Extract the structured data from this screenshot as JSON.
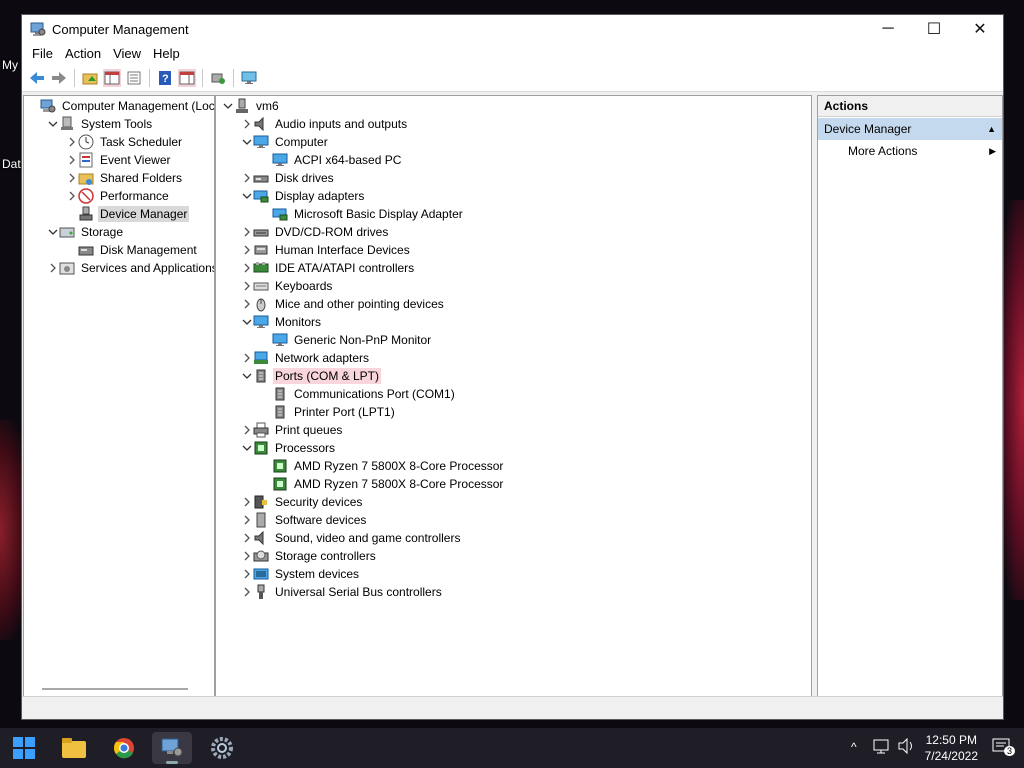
{
  "desktop": {
    "labels": [
      "My",
      "Dat"
    ]
  },
  "window": {
    "title": "Computer Management",
    "controls": {
      "minimize": "─",
      "maximize": "☐",
      "close": "✕"
    }
  },
  "menu": [
    "File",
    "Action",
    "View",
    "Help"
  ],
  "toolbar_icons": [
    "back-icon",
    "forward-icon",
    "up-folder-icon",
    "show-hide-tree-icon",
    "properties-icon",
    "help-icon",
    "show-hide-action-pane-icon",
    "update-driver-icon",
    "monitor-icon"
  ],
  "left_tree": [
    {
      "label": "Computer Management (Local",
      "level": 0,
      "expander": "none",
      "icon": "computer-management-icon"
    },
    {
      "label": "System Tools",
      "level": 1,
      "expander": "open",
      "icon": "system-tools-icon"
    },
    {
      "label": "Task Scheduler",
      "level": 2,
      "expander": "closed",
      "icon": "clock-icon"
    },
    {
      "label": "Event Viewer",
      "level": 2,
      "expander": "closed",
      "icon": "event-viewer-icon"
    },
    {
      "label": "Shared Folders",
      "level": 2,
      "expander": "closed",
      "icon": "shared-folder-icon"
    },
    {
      "label": "Performance",
      "level": 2,
      "expander": "closed",
      "icon": "performance-icon"
    },
    {
      "label": "Device Manager",
      "level": 2,
      "expander": "none",
      "icon": "device-manager-icon",
      "selected": true
    },
    {
      "label": "Storage",
      "level": 1,
      "expander": "open",
      "icon": "storage-icon"
    },
    {
      "label": "Disk Management",
      "level": 2,
      "expander": "none",
      "icon": "disk-icon"
    },
    {
      "label": "Services and Applications",
      "level": 1,
      "expander": "closed",
      "icon": "services-icon"
    }
  ],
  "device_tree": [
    {
      "label": "vm6",
      "level": 0,
      "expander": "open",
      "icon": "computer-root-icon"
    },
    {
      "label": "Audio inputs and outputs",
      "level": 1,
      "expander": "closed",
      "icon": "speaker-icon"
    },
    {
      "label": "Computer",
      "level": 1,
      "expander": "open",
      "icon": "monitor-icon"
    },
    {
      "label": "ACPI x64-based PC",
      "level": 2,
      "expander": "none",
      "icon": "monitor-icon"
    },
    {
      "label": "Disk drives",
      "level": 1,
      "expander": "closed",
      "icon": "disk-drive-icon"
    },
    {
      "label": "Display adapters",
      "level": 1,
      "expander": "open",
      "icon": "display-adapter-icon"
    },
    {
      "label": "Microsoft Basic Display Adapter",
      "level": 2,
      "expander": "none",
      "icon": "display-adapter-icon"
    },
    {
      "label": "DVD/CD-ROM drives",
      "level": 1,
      "expander": "closed",
      "icon": "dvd-drive-icon"
    },
    {
      "label": "Human Interface Devices",
      "level": 1,
      "expander": "closed",
      "icon": "hid-icon"
    },
    {
      "label": "IDE ATA/ATAPI controllers",
      "level": 1,
      "expander": "closed",
      "icon": "ide-controller-icon"
    },
    {
      "label": "Keyboards",
      "level": 1,
      "expander": "closed",
      "icon": "keyboard-icon"
    },
    {
      "label": "Mice and other pointing devices",
      "level": 1,
      "expander": "closed",
      "icon": "mouse-icon"
    },
    {
      "label": "Monitors",
      "level": 1,
      "expander": "open",
      "icon": "monitor-icon"
    },
    {
      "label": "Generic Non-PnP Monitor",
      "level": 2,
      "expander": "none",
      "icon": "monitor-icon"
    },
    {
      "label": "Network adapters",
      "level": 1,
      "expander": "closed",
      "icon": "network-adapter-icon"
    },
    {
      "label": "Ports (COM & LPT)",
      "level": 1,
      "expander": "open",
      "icon": "port-icon",
      "hover": true
    },
    {
      "label": "Communications Port (COM1)",
      "level": 2,
      "expander": "none",
      "icon": "port-icon"
    },
    {
      "label": "Printer Port (LPT1)",
      "level": 2,
      "expander": "none",
      "icon": "port-icon"
    },
    {
      "label": "Print queues",
      "level": 1,
      "expander": "closed",
      "icon": "printer-icon"
    },
    {
      "label": "Processors",
      "level": 1,
      "expander": "open",
      "icon": "processor-icon"
    },
    {
      "label": "AMD Ryzen 7 5800X 8-Core Processor",
      "level": 2,
      "expander": "none",
      "icon": "processor-icon"
    },
    {
      "label": "AMD Ryzen 7 5800X 8-Core Processor",
      "level": 2,
      "expander": "none",
      "icon": "processor-icon"
    },
    {
      "label": "Security devices",
      "level": 1,
      "expander": "closed",
      "icon": "security-device-icon"
    },
    {
      "label": "Software devices",
      "level": 1,
      "expander": "closed",
      "icon": "software-device-icon"
    },
    {
      "label": "Sound, video and game controllers",
      "level": 1,
      "expander": "closed",
      "icon": "speaker-icon"
    },
    {
      "label": "Storage controllers",
      "level": 1,
      "expander": "closed",
      "icon": "storage-controller-icon"
    },
    {
      "label": "System devices",
      "level": 1,
      "expander": "closed",
      "icon": "system-device-icon"
    },
    {
      "label": "Universal Serial Bus controllers",
      "level": 1,
      "expander": "closed",
      "icon": "usb-icon"
    }
  ],
  "actions": {
    "header": "Actions",
    "section": "Device Manager",
    "items": [
      "More Actions"
    ]
  },
  "taskbar": {
    "apps": [
      "start-icon",
      "file-explorer-icon",
      "chrome-icon",
      "computer-management-icon",
      "settings-icon"
    ],
    "active_app": "computer-management-icon",
    "tray_icons": [
      "chevron-up-icon",
      "network-icon",
      "volume-icon"
    ],
    "time": "12:50 PM",
    "date": "7/24/2022",
    "notification_count": "3"
  },
  "colors": {
    "selection": "#d9d9d9",
    "hover": "#f9d6dc",
    "actions_section": "#c5d9ee",
    "taskbar": "#1f1d26"
  }
}
